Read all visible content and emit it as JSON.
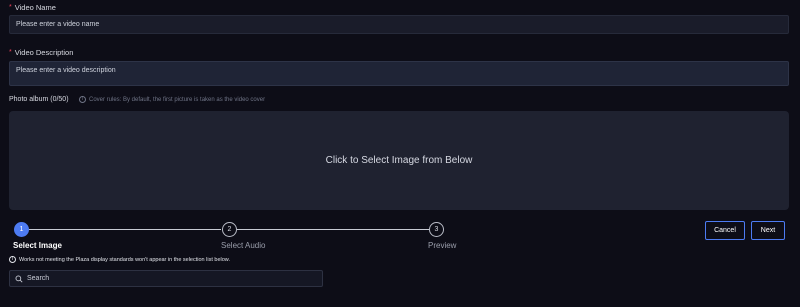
{
  "form": {
    "name": {
      "required_mark": "*",
      "label": "Video Name",
      "placeholder": "Please enter a video name"
    },
    "description": {
      "required_mark": "*",
      "label": "Video Description",
      "placeholder": "Please enter a video description"
    },
    "album": {
      "label": "Photo album (0/50)",
      "hint": "Cover rules: By default, the first picture is taken as the video cover",
      "dropzone_text": "Click to Select Image from Below"
    }
  },
  "steps": [
    {
      "number": "1",
      "title": "Select Image",
      "active": true
    },
    {
      "number": "2",
      "title": "Select Audio",
      "active": false
    },
    {
      "number": "3",
      "title": "Preview",
      "active": false
    }
  ],
  "buttons": {
    "cancel": "Cancel",
    "next": "Next"
  },
  "notice": "Works not meeting the Plaza display standards won't appear in the selection list below.",
  "search": {
    "placeholder": "Search"
  },
  "colors": {
    "accent": "#4d7bf2",
    "required": "#f0435b",
    "background": "#0d0d17"
  }
}
